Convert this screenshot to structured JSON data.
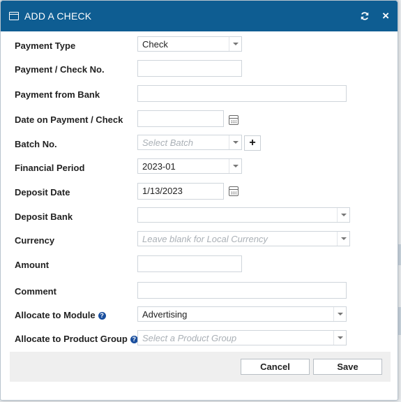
{
  "dialog": {
    "title": "ADD A CHECK",
    "refresh_icon": "refresh-icon",
    "close_label": "×"
  },
  "fields": {
    "payment_type": {
      "label": "Payment Type",
      "value": "Check"
    },
    "check_no": {
      "label": "Payment / Check No.",
      "value": ""
    },
    "payment_bank": {
      "label": "Payment from Bank",
      "value": ""
    },
    "check_date": {
      "label": "Date on Payment / Check",
      "value": ""
    },
    "batch_no": {
      "label": "Batch No.",
      "placeholder": "Select Batch",
      "add_label": "+"
    },
    "financial_period": {
      "label": "Financial Period",
      "value": "2023-01"
    },
    "deposit_date": {
      "label": "Deposit Date",
      "value": "1/13/2023"
    },
    "deposit_bank": {
      "label": "Deposit Bank",
      "value": ""
    },
    "currency": {
      "label": "Currency",
      "placeholder": "Leave blank for Local Currency"
    },
    "amount": {
      "label": "Amount",
      "value": ""
    },
    "comment": {
      "label": "Comment",
      "value": ""
    },
    "allocate_module": {
      "label": "Allocate to Module",
      "value": "Advertising",
      "help": "?"
    },
    "allocate_product_group": {
      "label": "Allocate to Product Group",
      "placeholder": "Select a Product Group",
      "help": "?"
    }
  },
  "footer": {
    "cancel_label": "Cancel",
    "save_label": "Save"
  },
  "colors": {
    "titlebar": "#0e5d92",
    "help_icon": "#1a4f9e"
  }
}
